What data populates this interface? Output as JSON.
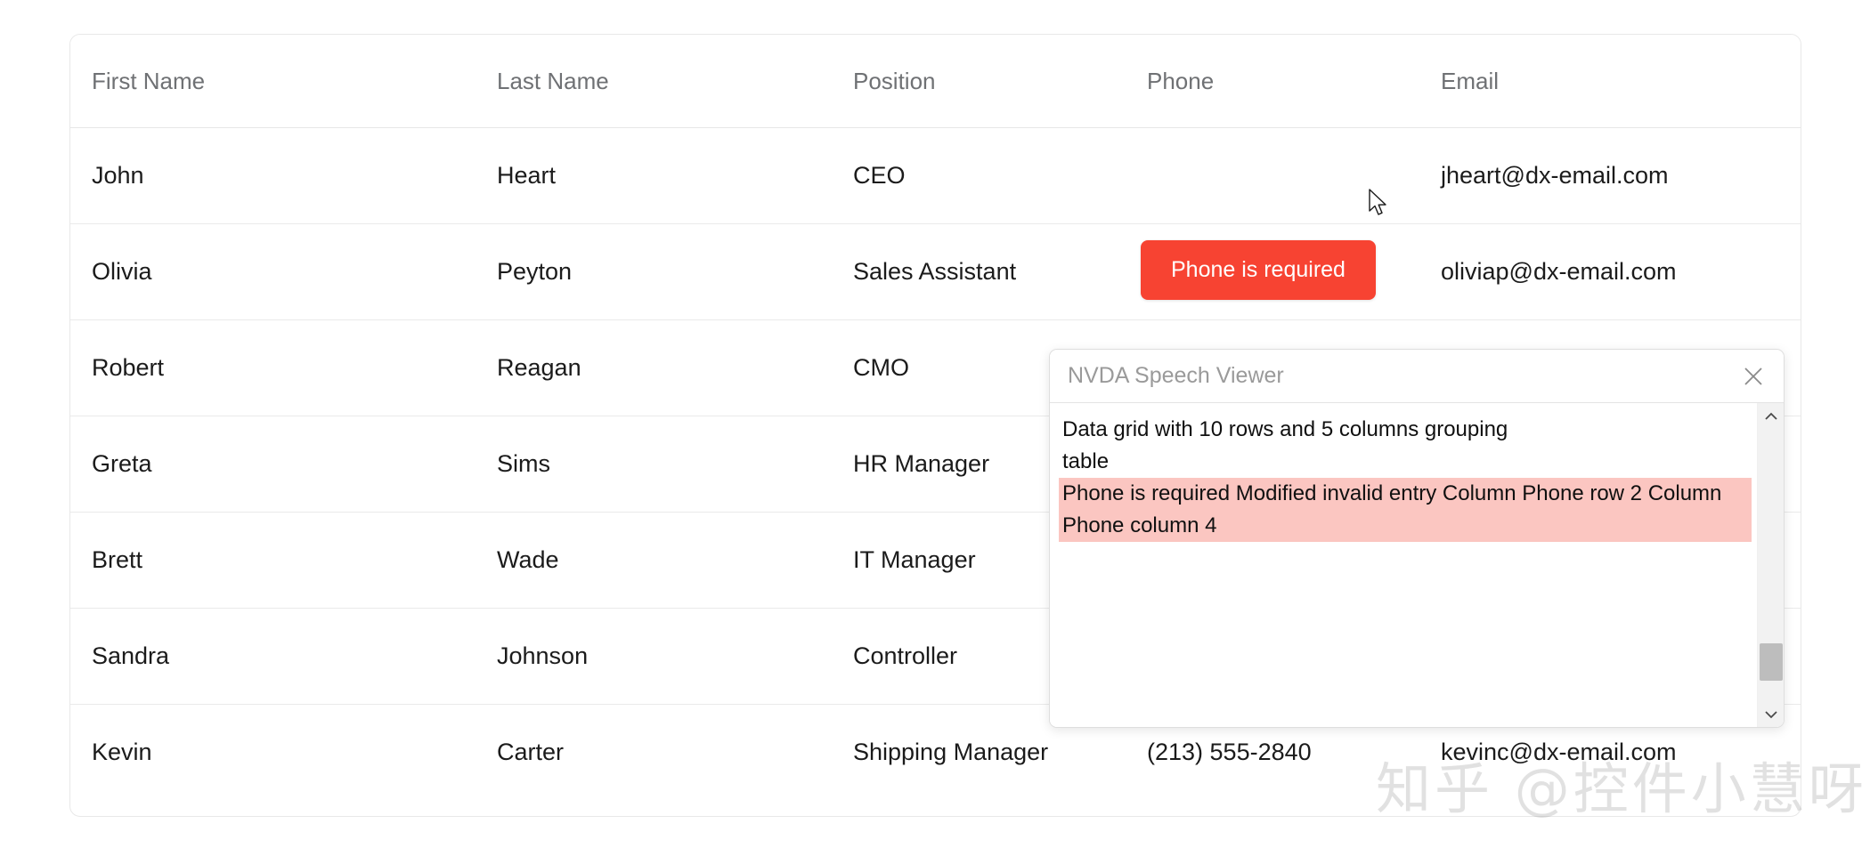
{
  "grid": {
    "columns": [
      "First Name",
      "Last Name",
      "Position",
      "Phone",
      "Email"
    ],
    "rows": [
      {
        "first_name": "John",
        "last_name": "Heart",
        "position": "CEO",
        "phone": "",
        "email": "jheart@dx-email.com",
        "phone_invalid": true
      },
      {
        "first_name": "Olivia",
        "last_name": "Peyton",
        "position": "Sales Assistant",
        "phone": "",
        "email": "oliviap@dx-email.com",
        "phone_invalid": false
      },
      {
        "first_name": "Robert",
        "last_name": "Reagan",
        "position": "CMO",
        "phone": "",
        "email": "",
        "phone_invalid": false
      },
      {
        "first_name": "Greta",
        "last_name": "Sims",
        "position": "HR Manager",
        "phone": "",
        "email": "",
        "phone_invalid": false
      },
      {
        "first_name": "Brett",
        "last_name": "Wade",
        "position": "IT Manager",
        "phone": "",
        "email": "",
        "phone_invalid": false
      },
      {
        "first_name": "Sandra",
        "last_name": "Johnson",
        "position": "Controller",
        "phone": "",
        "email": "",
        "phone_invalid": false
      },
      {
        "first_name": "Kevin",
        "last_name": "Carter",
        "position": "Shipping Manager",
        "phone": "(213) 555-2840",
        "email": "kevinc@dx-email.com",
        "phone_invalid": false
      }
    ]
  },
  "validation": {
    "message": "Phone is required",
    "background_color": "#f74332",
    "cell_background_color": "#fbc5bf"
  },
  "speech_viewer": {
    "title": "NVDA Speech Viewer",
    "close_icon": "close-icon",
    "lines": [
      {
        "text": "Data grid with 10 rows and 5 columns  grouping",
        "highlight": false
      },
      {
        "text": "table",
        "highlight": false
      },
      {
        "text": "Phone is required  Modified  invalid entry  Column Phone  row 2  Column",
        "highlight": true
      },
      {
        "text": "Phone  column 4",
        "highlight": true
      }
    ],
    "scrollbar": {
      "up_arrow_icon": "chevron-up-icon",
      "down_arrow_icon": "chevron-down-icon"
    }
  },
  "watermark": {
    "text": "知乎 @控件小慧呀"
  },
  "cursor": {
    "icon": "mouse-pointer-icon"
  }
}
